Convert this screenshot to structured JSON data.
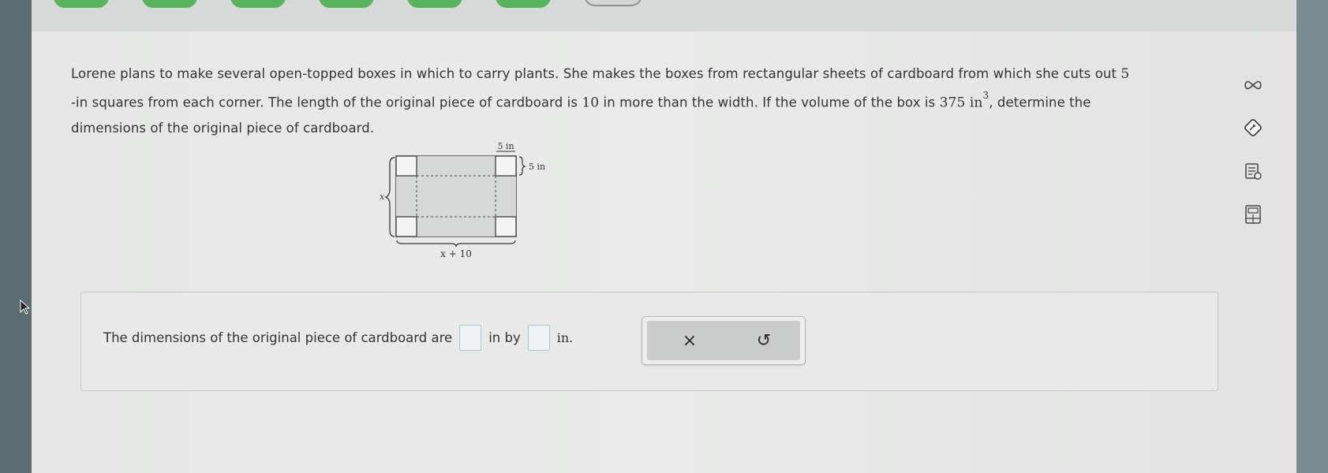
{
  "question": {
    "line1_a": "Lorene plans to make several open-topped boxes in which to carry plants. She makes the boxes from rectangular sheets of cardboard from which she cuts out ",
    "line1_num": "5",
    "line2_a": "-in squares from each corner. The length of the original piece of cardboard is ",
    "line2_num": "10",
    "line2_b": " in more than the width. If the volume of the box is ",
    "line2_vol": "375 in",
    "line2_exp": "3",
    "line2_c": ", determine the",
    "line3": "dimensions of the original piece of cardboard."
  },
  "figure": {
    "top_label": "5 in",
    "side_label": "5 in",
    "left_label": "x",
    "bottom_label": "x + 10"
  },
  "answer": {
    "prefix": "The dimensions of the original piece of cardboard are",
    "unit1": "in by",
    "unit2": "in."
  },
  "buttons": {
    "clear": "×",
    "undo": "↺"
  },
  "icons": [
    "infinity-icon",
    "edit-diamond-icon",
    "notes-icon",
    "calculator-icon",
    "cursor-arrow-icon"
  ],
  "colors": {
    "progress_complete": "#58b35c",
    "shaded_box": "#d6d7d7",
    "answer_border": "#c6c8c7"
  }
}
